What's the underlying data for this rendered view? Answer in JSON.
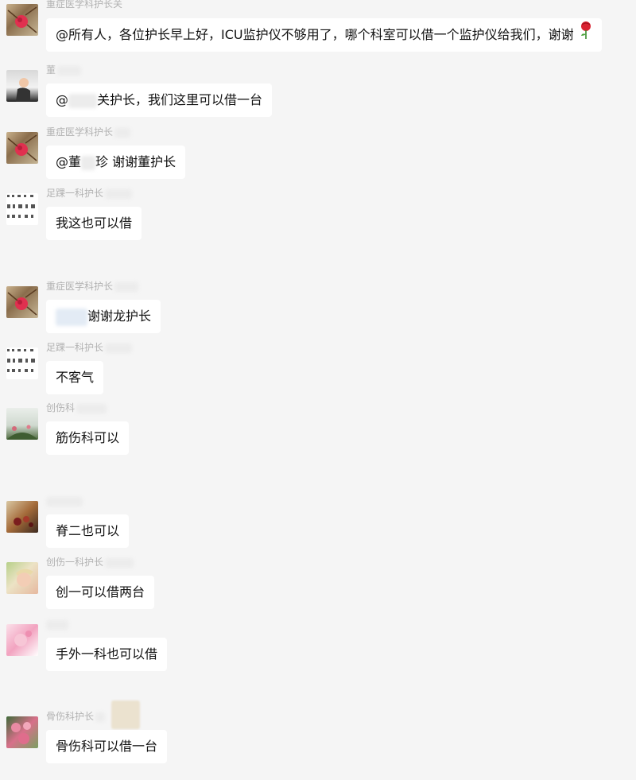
{
  "messages": [
    {
      "sender": "重症医学科护长关",
      "avatar": "rose-branch-avatar",
      "segments": [
        {
          "text": "@所有人，各位护长早上好，ICU监护仪不够用了，哪个科室可以借一个监护仪给我们，谢谢"
        },
        {
          "emoji": "rose-emoji"
        }
      ]
    },
    {
      "sender": "董",
      "avatar": "girl-avatar",
      "segments": [
        {
          "text": "@"
        },
        {
          "redacted": true
        },
        {
          "text": "关护长，我们这里可以借一台"
        }
      ]
    },
    {
      "sender": "重症医学科护长",
      "avatar": "rose-branch-avatar",
      "segments": [
        {
          "text": "@董"
        },
        {
          "redacted": true
        },
        {
          "text": "珍 谢谢董护长"
        }
      ]
    },
    {
      "sender": "足踝一科护长",
      "avatar": "grid-pattern-avatar",
      "segments": [
        {
          "text": "我这也可以借"
        }
      ]
    },
    {
      "sender": "重症医学科护长",
      "avatar": "rose-branch-avatar",
      "segments": [
        {
          "redacted": true
        },
        {
          "text": "谢谢龙护长"
        }
      ]
    },
    {
      "sender": "足踝一科护长",
      "avatar": "grid-pattern-avatar",
      "segments": [
        {
          "text": "不客气"
        }
      ]
    },
    {
      "sender": "创伤科",
      "avatar": "plant-avatar",
      "segments": [
        {
          "text": "筋伤科可以"
        }
      ]
    },
    {
      "sender": "",
      "avatar": "flowers-avatar",
      "segments": [
        {
          "text": "脊二也可以"
        }
      ]
    },
    {
      "sender": "创伤一科护长",
      "avatar": "child-avatar",
      "segments": [
        {
          "text": "创一可以借两台"
        }
      ]
    },
    {
      "sender": "",
      "avatar": "pink-avatar",
      "segments": [
        {
          "text": "手外一科也可以借"
        }
      ]
    },
    {
      "sender": "骨伤科护长",
      "avatar": "peony-avatar",
      "segments": [
        {
          "text": "骨伤科可以借一台"
        }
      ]
    }
  ]
}
